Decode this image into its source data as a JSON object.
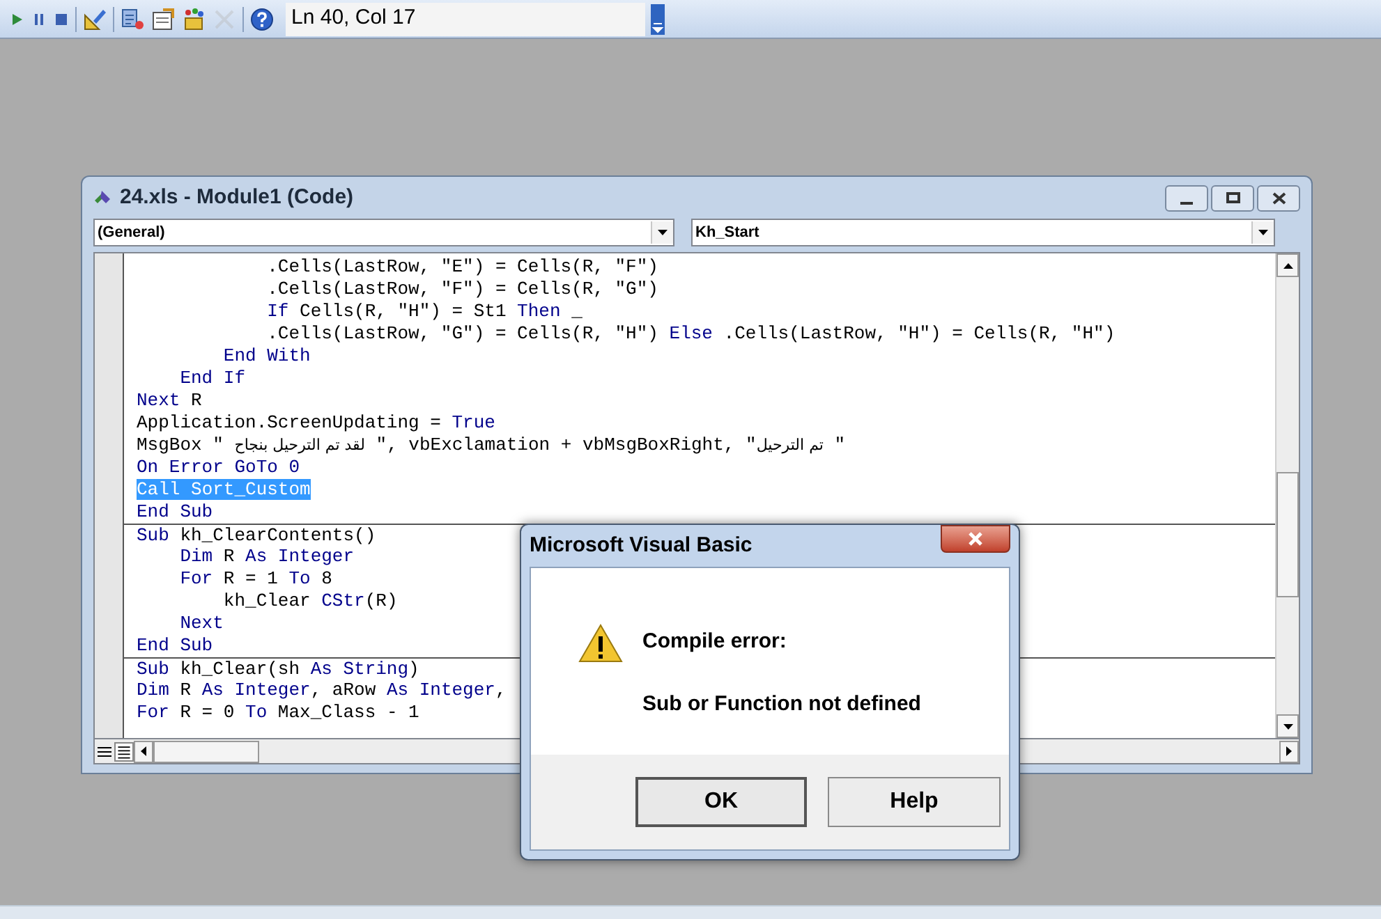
{
  "toolbar": {
    "buttons": [
      {
        "disabled": false
      },
      {
        "disabled": false
      },
      {
        "disabled": false
      },
      {
        "disabled": false
      },
      {
        "disabled": false
      },
      {
        "disabled": false
      },
      {
        "disabled": false
      },
      {
        "disabled": true
      },
      {
        "disabled": false
      }
    ],
    "position": "Ln 40, Col 17"
  },
  "code_window": {
    "title": "24.xls - Module1 (Code)",
    "object_dropdown": "(General)",
    "procedure_dropdown": "Kh_Start",
    "lines": [
      {
        "separator": false,
        "selected": false,
        "segments": [
          {
            "kind": "plain",
            "text": "            .Cells(LastRow, \"E\") = Cells(R, \"F\")"
          }
        ]
      },
      {
        "separator": false,
        "selected": false,
        "segments": [
          {
            "kind": "plain",
            "text": "            .Cells(LastRow, \"F\") = Cells(R, \"G\")"
          }
        ]
      },
      {
        "separator": false,
        "selected": false,
        "segments": [
          {
            "kind": "keyword",
            "text": "            If"
          },
          {
            "kind": "plain",
            "text": " Cells(R, \"H\") = St1 "
          },
          {
            "kind": "keyword",
            "text": "Then"
          },
          {
            "kind": "plain",
            "text": " _"
          }
        ]
      },
      {
        "separator": false,
        "selected": false,
        "segments": [
          {
            "kind": "plain",
            "text": "            .Cells(LastRow, \"G\") = Cells(R, \"H\") "
          },
          {
            "kind": "keyword",
            "text": "Else"
          },
          {
            "kind": "plain",
            "text": " .Cells(LastRow, \"H\") = Cells(R, \"H\")"
          }
        ]
      },
      {
        "separator": false,
        "selected": false,
        "segments": [
          {
            "kind": "keyword",
            "text": "        End With"
          }
        ]
      },
      {
        "separator": false,
        "selected": false,
        "segments": [
          {
            "kind": "keyword",
            "text": "    End If"
          }
        ]
      },
      {
        "separator": false,
        "selected": false,
        "segments": [
          {
            "kind": "keyword",
            "text": "Next"
          },
          {
            "kind": "plain",
            "text": " R"
          }
        ]
      },
      {
        "separator": false,
        "selected": false,
        "segments": [
          {
            "kind": "plain",
            "text": "Application.ScreenUpdating = "
          },
          {
            "kind": "keyword",
            "text": "True"
          }
        ]
      },
      {
        "separator": false,
        "selected": false,
        "segments": [
          {
            "kind": "plain",
            "text": "MsgBox \" "
          },
          {
            "kind": "rtl",
            "text": "لقد تم الترحيل بنجاح"
          },
          {
            "kind": "plain",
            "text": " \", vbExclamation + vbMsgBoxRight, \""
          },
          {
            "kind": "rtl",
            "text": "تم الترحيل"
          },
          {
            "kind": "plain",
            "text": " \""
          }
        ]
      },
      {
        "separator": false,
        "selected": false,
        "segments": [
          {
            "kind": "keyword",
            "text": "On Error GoTo 0"
          }
        ]
      },
      {
        "separator": false,
        "selected": true,
        "segments": [
          {
            "kind": "keyword",
            "text": "Call"
          },
          {
            "kind": "plain",
            "text": " Sort_Custom"
          }
        ]
      },
      {
        "separator": false,
        "selected": false,
        "segments": [
          {
            "kind": "keyword",
            "text": "End Sub"
          }
        ]
      },
      {
        "separator": true,
        "selected": false,
        "segments": [
          {
            "kind": "keyword",
            "text": "Sub"
          },
          {
            "kind": "plain",
            "text": " kh_ClearContents()"
          }
        ]
      },
      {
        "separator": false,
        "selected": false,
        "segments": [
          {
            "kind": "keyword",
            "text": "    Dim"
          },
          {
            "kind": "plain",
            "text": " R "
          },
          {
            "kind": "keyword",
            "text": "As Integer"
          }
        ]
      },
      {
        "separator": false,
        "selected": false,
        "segments": [
          {
            "kind": "keyword",
            "text": "    For"
          },
          {
            "kind": "plain",
            "text": " R = 1 "
          },
          {
            "kind": "keyword",
            "text": "To"
          },
          {
            "kind": "plain",
            "text": " 8"
          }
        ]
      },
      {
        "separator": false,
        "selected": false,
        "segments": [
          {
            "kind": "plain",
            "text": "        kh_Clear "
          },
          {
            "kind": "keyword",
            "text": "CStr"
          },
          {
            "kind": "plain",
            "text": "(R)"
          }
        ]
      },
      {
        "separator": false,
        "selected": false,
        "segments": [
          {
            "kind": "keyword",
            "text": "    Next"
          }
        ]
      },
      {
        "separator": false,
        "selected": false,
        "segments": [
          {
            "kind": "keyword",
            "text": "End Sub"
          }
        ]
      },
      {
        "separator": true,
        "selected": false,
        "segments": [
          {
            "kind": "keyword",
            "text": "Sub"
          },
          {
            "kind": "plain",
            "text": " kh_Clear(sh "
          },
          {
            "kind": "keyword",
            "text": "As String"
          },
          {
            "kind": "plain",
            "text": ")"
          }
        ]
      },
      {
        "separator": false,
        "selected": false,
        "segments": [
          {
            "kind": "keyword",
            "text": "Dim"
          },
          {
            "kind": "plain",
            "text": " R "
          },
          {
            "kind": "keyword",
            "text": "As Integer"
          },
          {
            "kind": "plain",
            "text": ", aRow "
          },
          {
            "kind": "keyword",
            "text": "As Integer"
          },
          {
            "kind": "plain",
            "text": ","
          }
        ]
      },
      {
        "separator": false,
        "selected": false,
        "segments": [
          {
            "kind": "keyword",
            "text": "For"
          },
          {
            "kind": "plain",
            "text": " R = 0 "
          },
          {
            "kind": "keyword",
            "text": "To"
          },
          {
            "kind": "plain",
            "text": " Max_Class - 1"
          }
        ]
      }
    ]
  },
  "dialog": {
    "title": "Microsoft Visual Basic",
    "heading": "Compile error:",
    "message": "Sub or Function not defined",
    "buttons": [
      {
        "label": "OK",
        "default": true
      },
      {
        "label": "Help",
        "default": false
      }
    ]
  }
}
